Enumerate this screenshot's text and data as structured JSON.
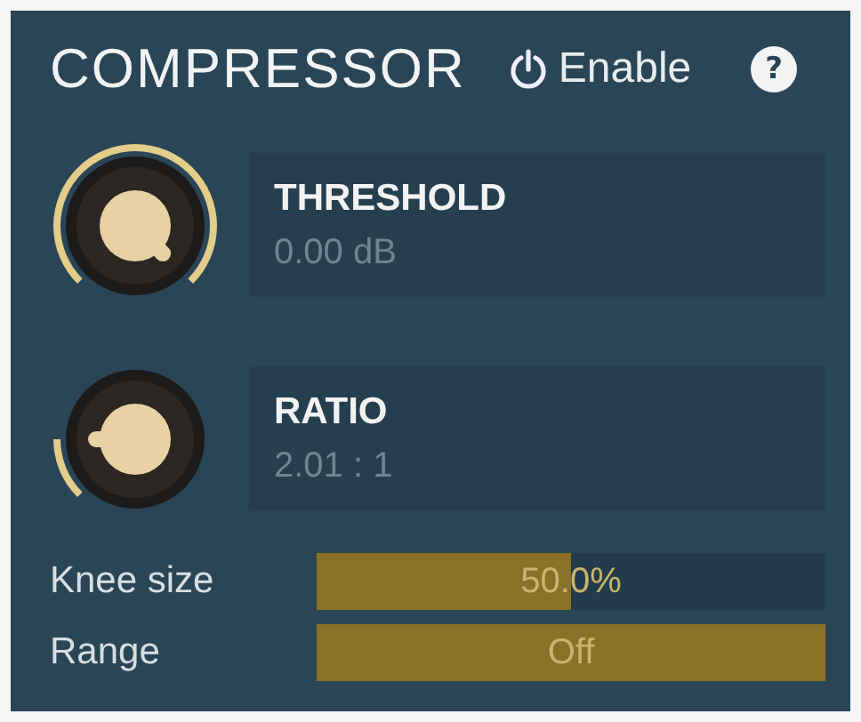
{
  "header": {
    "title": "COMPRESSOR",
    "enable_label": "Enable",
    "help": "?"
  },
  "knobs": [
    {
      "label": "THRESHOLD",
      "value": "0.00 dB"
    },
    {
      "label": "RATIO",
      "value": "2.01 : 1"
    }
  ],
  "sliders": [
    {
      "label": "Knee size",
      "value": "50.0%",
      "level": 0.5
    },
    {
      "label": "Range",
      "value": "Off",
      "level": 1.0
    }
  ]
}
